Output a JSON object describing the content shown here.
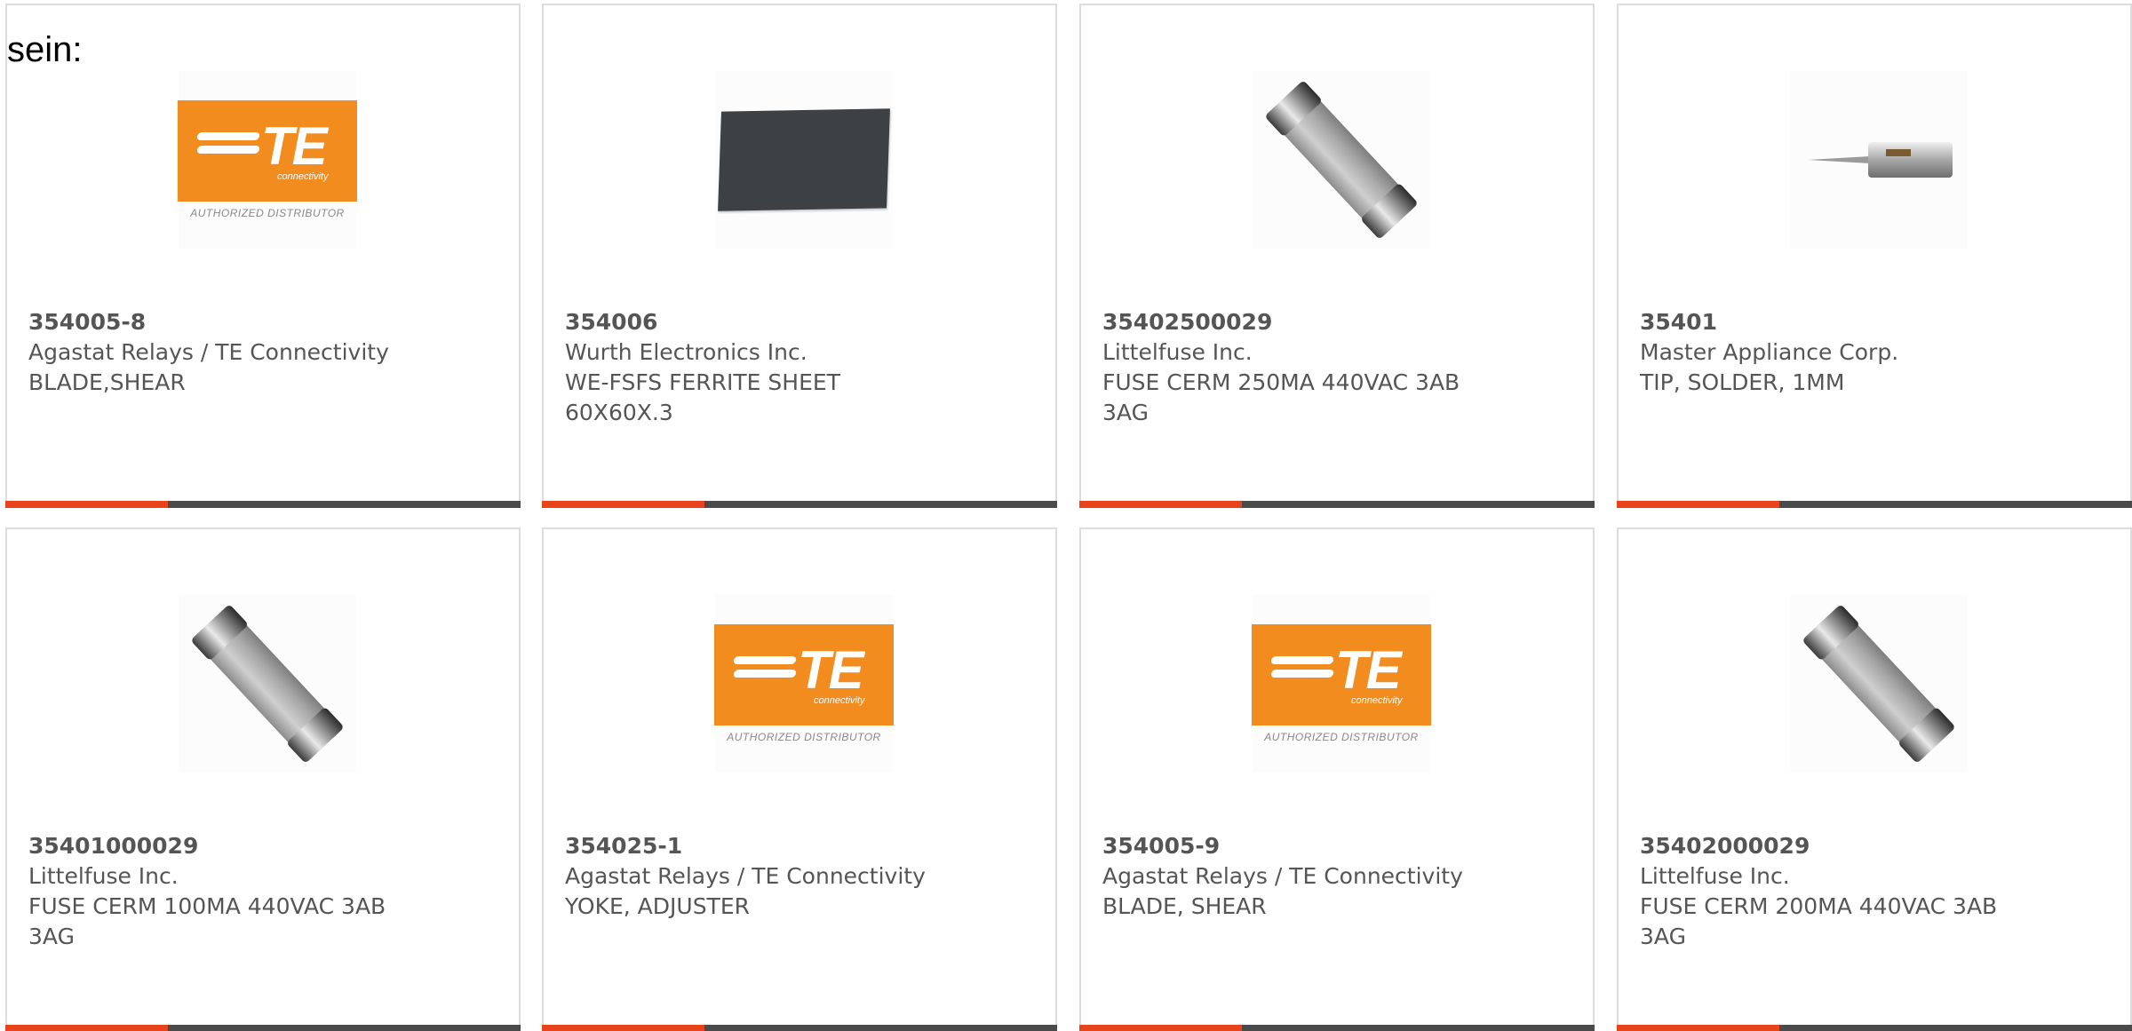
{
  "intro_text": "sein:",
  "logo": {
    "te_word": "TE",
    "te_sub": "connectivity",
    "te_authorized": "AUTHORIZED DISTRIBUTOR"
  },
  "colors": {
    "accent": "#e8431a",
    "bar": "#4a4a4a",
    "text": "#555555",
    "te_orange": "#f28c1f"
  },
  "products": [
    {
      "part": "354005-8",
      "manufacturer": "Agastat Relays / TE Connectivity",
      "description": "BLADE,SHEAR",
      "image": "te-logo"
    },
    {
      "part": "354006",
      "manufacturer": "Wurth Electronics Inc.",
      "description": "WE-FSFS FERRITE SHEET 60X60X.3",
      "image": "ferrite-sheet"
    },
    {
      "part": "35402500029",
      "manufacturer": "Littelfuse Inc.",
      "description": "FUSE CERM 250MA 440VAC 3AB 3AG",
      "image": "fuse"
    },
    {
      "part": "35401",
      "manufacturer": "Master Appliance Corp.",
      "description": "TIP, SOLDER, 1MM",
      "image": "solder-tip"
    },
    {
      "part": "35401000029",
      "manufacturer": "Littelfuse Inc.",
      "description": "FUSE CERM 100MA 440VAC 3AB 3AG",
      "image": "fuse"
    },
    {
      "part": "354025-1",
      "manufacturer": "Agastat Relays / TE Connectivity",
      "description": "YOKE, ADJUSTER",
      "image": "te-logo"
    },
    {
      "part": "354005-9",
      "manufacturer": "Agastat Relays / TE Connectivity",
      "description": "BLADE, SHEAR",
      "image": "te-logo"
    },
    {
      "part": "35402000029",
      "manufacturer": "Littelfuse Inc.",
      "description": "FUSE CERM 200MA 440VAC 3AB 3AG",
      "image": "fuse"
    }
  ]
}
